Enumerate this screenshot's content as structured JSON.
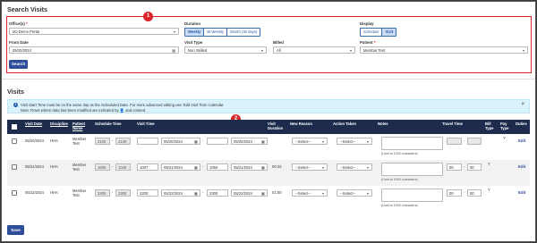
{
  "search": {
    "title": "Search Visits",
    "badge": "1",
    "offices_label": "Office(s)",
    "offices_value": "MJ Demo Portal",
    "duration_label": "Duration",
    "duration_options": [
      "Weekly",
      "Bi-Weekly",
      "Month (30 days)"
    ],
    "duration_selected": "Weekly",
    "display_label": "Display",
    "display_options": [
      "Schedule",
      "Visit"
    ],
    "display_selected": "Visit",
    "from_date_label": "From Date",
    "from_date_value": "05/20/2024",
    "visit_type_label": "Visit Type",
    "visit_type_value": "Non Skilled",
    "billed_label": "Billed",
    "billed_value": "All",
    "patient_label": "Patient",
    "patient_value": "Membar Test",
    "required_mark": "*",
    "search_button": "Search"
  },
  "visits": {
    "title": "Visits",
    "badge": "2",
    "info_line1": "Visit Start Time must be on the same day as the Scheduled Date. For more advanced editing use 'Edit Visit' from Calendar.",
    "info_line2": "Note: Rows where data has been modified are indicated by",
    "info_line2_end": "and colored.",
    "headers": {
      "visit_date": "Visit Date",
      "discipline": "Discipline",
      "patient_name": "Patient Name",
      "schedule_time": "Schedule Time",
      "visit_time": "Visit Time",
      "visit_duration": "Visit Duration",
      "new_reason": "New Reason",
      "action_taken": "Action Taken",
      "notes": "Notes",
      "travel_time": "Travel Time",
      "bill_type": "Bill Type",
      "pay_type": "Pay Type",
      "duties": "Duties"
    },
    "rows": [
      {
        "visit_date": "05/20/2024",
        "discipline": "HHA",
        "patient": "Member Test",
        "sched_start": "2100",
        "sched_end": "2130",
        "visit_start": "",
        "start_date": "05/20/2024",
        "visit_end": "",
        "end_date": "05/20/2024",
        "duration": "",
        "reason": "--Select--",
        "action": "--Select--",
        "limit": "(Limit to 1000 characters)",
        "travel_h": "",
        "travel_m": "",
        "bill": "",
        "pay": "Y",
        "edit": "Edit"
      },
      {
        "visit_date": "05/21/2024",
        "discipline": "HHA",
        "patient": "Member Test",
        "sched_start": "1000",
        "sched_end": "1045",
        "visit_start": "1007",
        "start_date": "05/21/2024",
        "visit_end": "1050",
        "end_date": "05/21/2024",
        "duration": "00:43",
        "reason": "--Select--",
        "action": "--Select--",
        "limit": "(Limit to 1000 characters)",
        "travel_h": "00",
        "travel_m": "00",
        "bill": "Y",
        "pay": "",
        "edit": "Edit"
      },
      {
        "visit_date": "05/22/2024",
        "discipline": "HHA",
        "patient": "Member Test",
        "sched_start": "2200",
        "sched_end": "2300",
        "visit_start": "2200",
        "start_date": "05/22/2024",
        "visit_end": "2300",
        "end_date": "05/22/2024",
        "duration": "01:00",
        "reason": "--Select--",
        "action": "--Select--",
        "limit": "(Limit to 1000 characters)",
        "travel_h": "00",
        "travel_m": "00",
        "bill": "Y",
        "pay": "",
        "edit": "Edit"
      }
    ],
    "save_button": "Save"
  },
  "colors": {
    "accent": "#2e4d9a",
    "header_bg": "#1d2b4d",
    "annotation": "#d9262c",
    "info_bg": "#d9f2fb"
  }
}
